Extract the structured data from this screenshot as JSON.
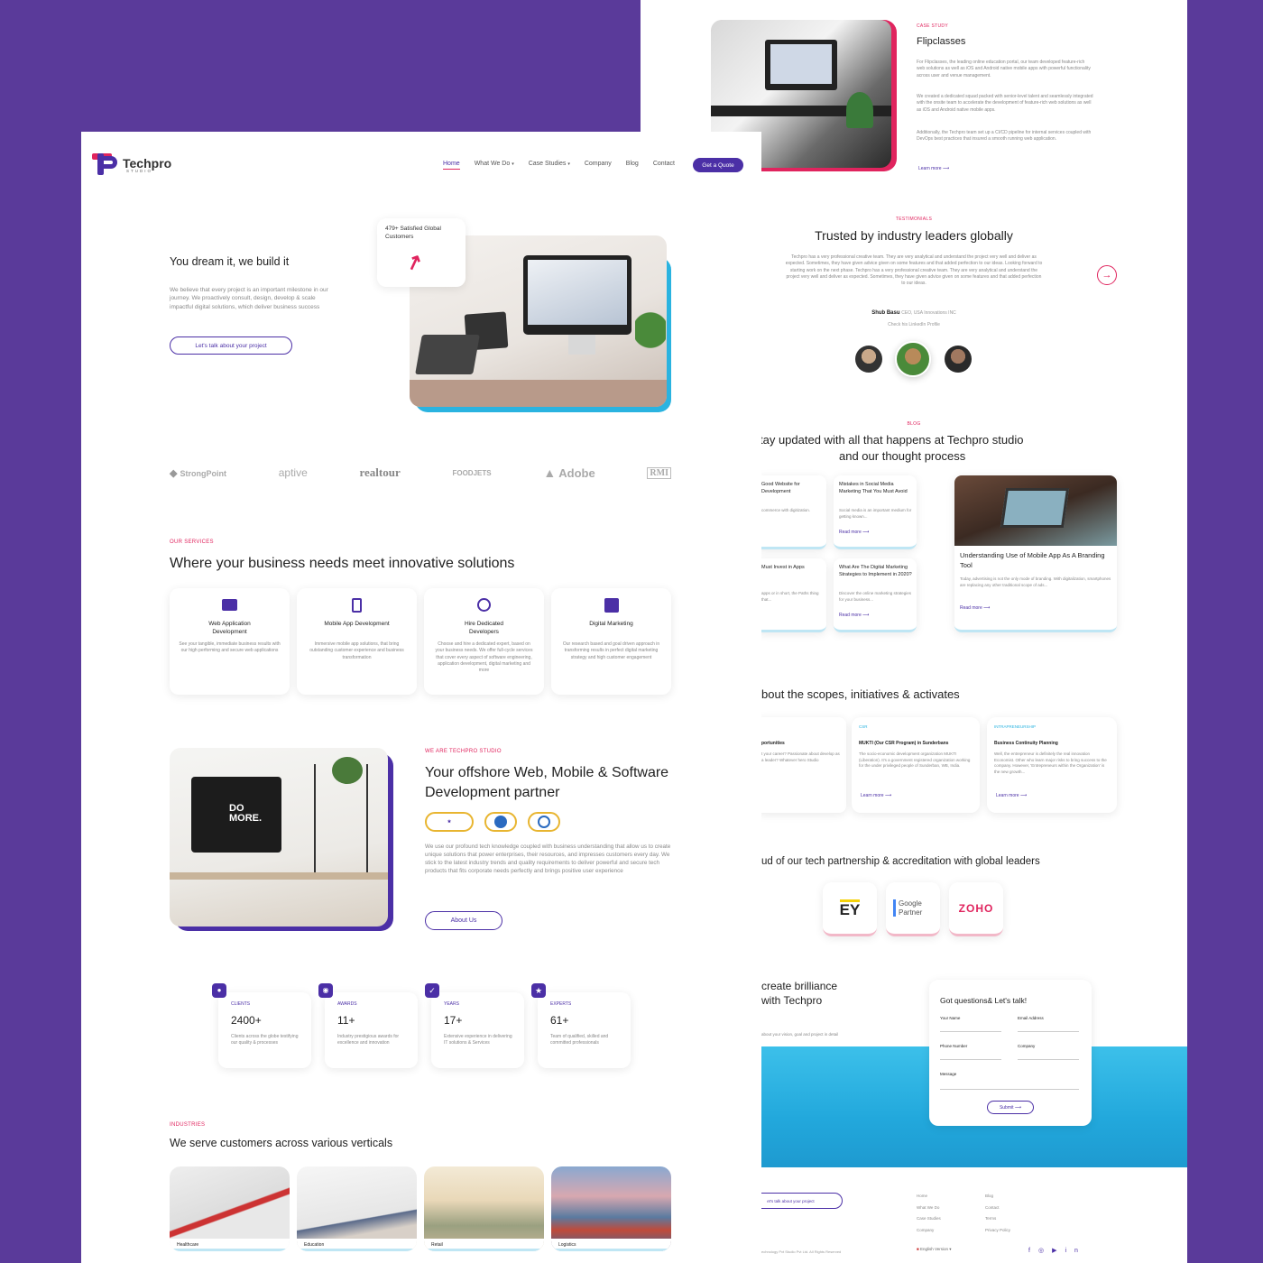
{
  "colors": {
    "background": "#5a3a9a",
    "brand": "#4b2fa6",
    "accent": "#e0245e",
    "cyan": "#2ab3e0"
  },
  "front": {
    "logo": {
      "name": "Techpro",
      "sub": "STUDIO"
    },
    "nav": [
      {
        "label": "Home"
      },
      {
        "label": "What We Do"
      },
      {
        "label": "Case Studies"
      },
      {
        "label": "Company"
      },
      {
        "label": "Blog"
      },
      {
        "label": "Contact"
      }
    ],
    "quote_button": "Get a Quote",
    "hero": {
      "title": "You dream it, we build it",
      "text": "We believe that every project is an important milestone in our journey. We proactively consult, design, develop & scale impactful digital solutions, which deliver business success",
      "cta": "Let's talk about your project",
      "badge": "479+ Satisfied Global Customers"
    },
    "clients": [
      "StrongPoint",
      "aptive",
      "realtour",
      "FOODJETS",
      "Adobe",
      "RMI"
    ],
    "services": {
      "eyebrow": "OUR SERVICES",
      "title": "Where your business needs meet innovative solutions",
      "items": [
        {
          "title": "Web Application Development",
          "text": "See your tangible, immediate business results with our high performing and secure web applications",
          "icon": "monitor-icon"
        },
        {
          "title": "Mobile App Development",
          "text": "Immersive mobile app solutions, that bring outstanding customer experience and business transformation",
          "icon": "mobile-icon"
        },
        {
          "title": "Hire Dedicated Developers",
          "text": "Choose and hire a dedicated expert, based on your business needs. We offer full-cycle services that cover every aspect of software engineering, application development, digital marketing and more",
          "icon": "developer-icon"
        },
        {
          "title": "Digital Marketing",
          "text": "Our research based and goal driven approach in transforming results in perfect digital marketing strategy and high customer engagement",
          "icon": "marketing-icon"
        }
      ]
    },
    "about": {
      "eyebrow": "WE ARE TECHPRO STUDIO",
      "title": "Your offshore Web, Mobile & Software Development partner",
      "text": "We use our profound tech knowledge coupled with business understanding that allow us to create unique solutions that power enterprises, their resources, and impresses customers every day. We stick to the latest industry trends and quality requirements to deliver powerful and secure tech products that fits corporate needs perfectly and brings positive user experience",
      "button": "About Us",
      "screen_text": "DO MORE."
    },
    "stats": [
      {
        "label": "CLIENTS",
        "value": "2400+",
        "text": "Clients across the globe testifying our quality & processes"
      },
      {
        "label": "AWARDS",
        "value": "11+",
        "text": "Industry prestigious awards for excellence and innovation"
      },
      {
        "label": "YEARS",
        "value": "17+",
        "text": "Extensive experience in delivering IT solutions & Services"
      },
      {
        "label": "EXPERTS",
        "value": "61+",
        "text": "Team of qualified, skilled and committed professionals"
      }
    ],
    "industries": {
      "eyebrow": "INDUSTRIES",
      "title": "We serve customers across various verticals",
      "items": [
        "Healthcare",
        "Education",
        "Retail",
        "Logistics"
      ]
    }
  },
  "back": {
    "case_study": {
      "eyebrow": "CASE STUDY",
      "title": "Flipclasses",
      "p1": "For Flipclasses, the leading online education portal, our team developed feature-rich web solutions as well as iOS and Android native mobile apps with powerful functionality across user and venue management.",
      "p2": "We created a dedicated squad packed with senior-level talent and seamlessly integrated with the onsite team to accelerate the development of feature-rich web solutions as well as iOS and Android native mobile apps.",
      "p3": "Additionally, the Techpro team set up a CI/CD pipeline for internal services coupled with DevOps best practices that insured a smooth running web application.",
      "link": "Learn more"
    },
    "testimonials": {
      "eyebrow": "TESTIMONIALS",
      "title": "Trusted by industry leaders globally",
      "quote": "Techpro has a very professional creative team. They are very analytical and understand the project very well and deliver as expected. Sometimes, they have given advice given on some features and that added perfection to our ideas. Looking forward to starting work on the next phase. Techpro has a very professional creative team. They are very analytical and understand the project very well and deliver as expected. Sometimes, they have given advice given on some features and that added perfection to our ideas.",
      "author": "Shub Basu",
      "role": "CEO, USA Innovations INC",
      "profile": "Check his LinkedIn Profile"
    },
    "blog": {
      "eyebrow": "BLOG",
      "title_line1": "tay updated with all that happens at Techpro studio",
      "title_line2": "and our thought process",
      "posts": [
        {
          "title": "Good Website for Development",
          "text": "commerce with digitization."
        },
        {
          "title": "Mistakes in Social Media Marketing That You Must Avoid",
          "text": "Social media is an important medium for getting known...",
          "link": "Read more"
        },
        {
          "title": "Must Invest in Apps",
          "text": "apps or in short, the Paths thing that..."
        },
        {
          "title": "What Are The Digital Marketing Strategies to Implement in 2020?",
          "text": "Discover the online marketing strategies for your business...",
          "link": "Read more"
        },
        {
          "title": "Understanding Use of Mobile App As A Branding Tool",
          "text": "Today, advertising is not the only mode of branding. With digitalization, smartphones are replacing any other traditional scope of ads...",
          "link": "Read more"
        }
      ]
    },
    "scopes": {
      "title": "bout the scopes, initiatives & activates",
      "items": [
        {
          "tag": "",
          "title": "portunities",
          "text": "t your career? Passionate about develop as a leader? Whatever hero Studio"
        },
        {
          "tag": "CSR",
          "title": "MUKTI (Our CSR Program) in Sunderbans",
          "text": "The socio-economic development organization MUKTI (Liberation). It's a government registered organization working for the under privileged people of Sunderban, WB, India.",
          "link": "Learn more"
        },
        {
          "tag": "INTRAPRENEURSHIP",
          "title": "Business Continuity Planning",
          "text": "Well, the entrepreneur is definitely the real innovation Economist. Other who learn major risks to bring success to the company. However, 'Entrepreneurs within the Organization' is the new growth...",
          "link": "Learn more"
        }
      ]
    },
    "partners": {
      "title": "ud of our tech partnership & accreditation with global leaders",
      "items": [
        "EY",
        "Google Partner",
        "ZOHO"
      ]
    },
    "contact": {
      "title_line1": "create brilliance",
      "title_line2": "with Techpro",
      "sub": "about your vision, goal and project in detail",
      "form_title": "Got questions& Let's talk!",
      "fields": [
        "Your Name",
        "Email Address",
        "Phone Number",
        "Company",
        "Message"
      ],
      "submit": "Submit"
    },
    "footer": {
      "cta": "et's talk about your project",
      "col1": [
        "Home",
        "What We Do",
        "Case Studies",
        "Company"
      ],
      "col2": [
        "Blog",
        "Contact",
        "Terms",
        "Privacy Policy"
      ],
      "copyright": "echnology Pvt Studio Pvt Ltd. All Rights Reserved",
      "language": "English Version"
    }
  }
}
